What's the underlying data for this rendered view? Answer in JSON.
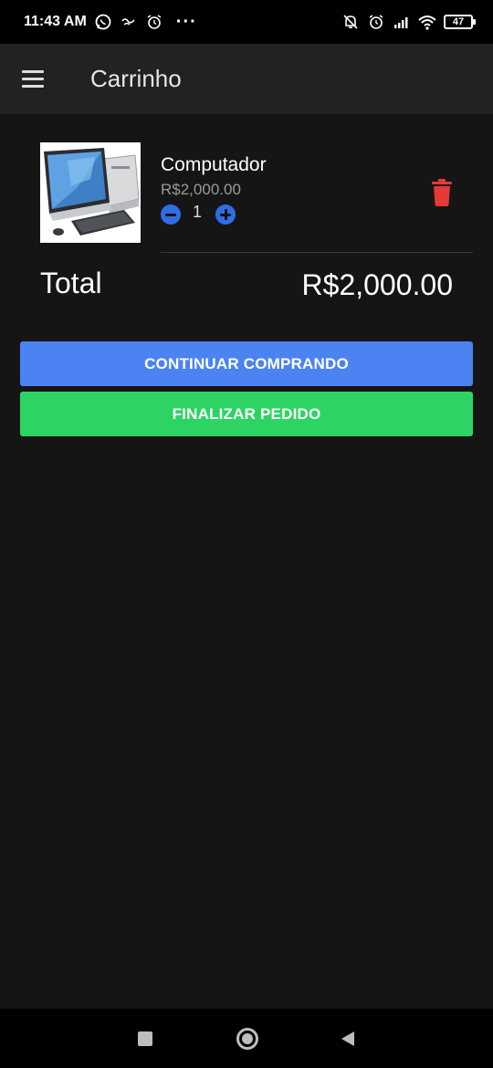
{
  "status_bar": {
    "time": "11:43 AM",
    "dots": "···",
    "battery": "47",
    "icons": [
      "whatsapp-icon",
      "notification-icon",
      "alarm-icon",
      "silent-icon",
      "alarm-icon",
      "signal-icon",
      "wifi-icon",
      "battery-icon"
    ]
  },
  "app_bar": {
    "title": "Carrinho",
    "menu_icon": "menu-icon"
  },
  "cart": {
    "items": [
      {
        "name": "Computador",
        "price": "R$2,000.00",
        "quantity": "1",
        "image": "desktop-computer-image"
      }
    ]
  },
  "total": {
    "label": "Total",
    "value": "R$2,000.00"
  },
  "buttons": {
    "continue": "CONTINUAR COMPRANDO",
    "finish": "FINALIZAR PEDIDO"
  },
  "colors": {
    "background": "#151515",
    "app_bar": "#222222",
    "continue_button": "#4c83f2",
    "finish_button": "#2ed463",
    "delete_icon": "#e53935",
    "quantity_buttons": "#2f6de8"
  },
  "nav_bar": {
    "icons": [
      "recent-apps-icon",
      "home-icon",
      "back-icon"
    ]
  }
}
